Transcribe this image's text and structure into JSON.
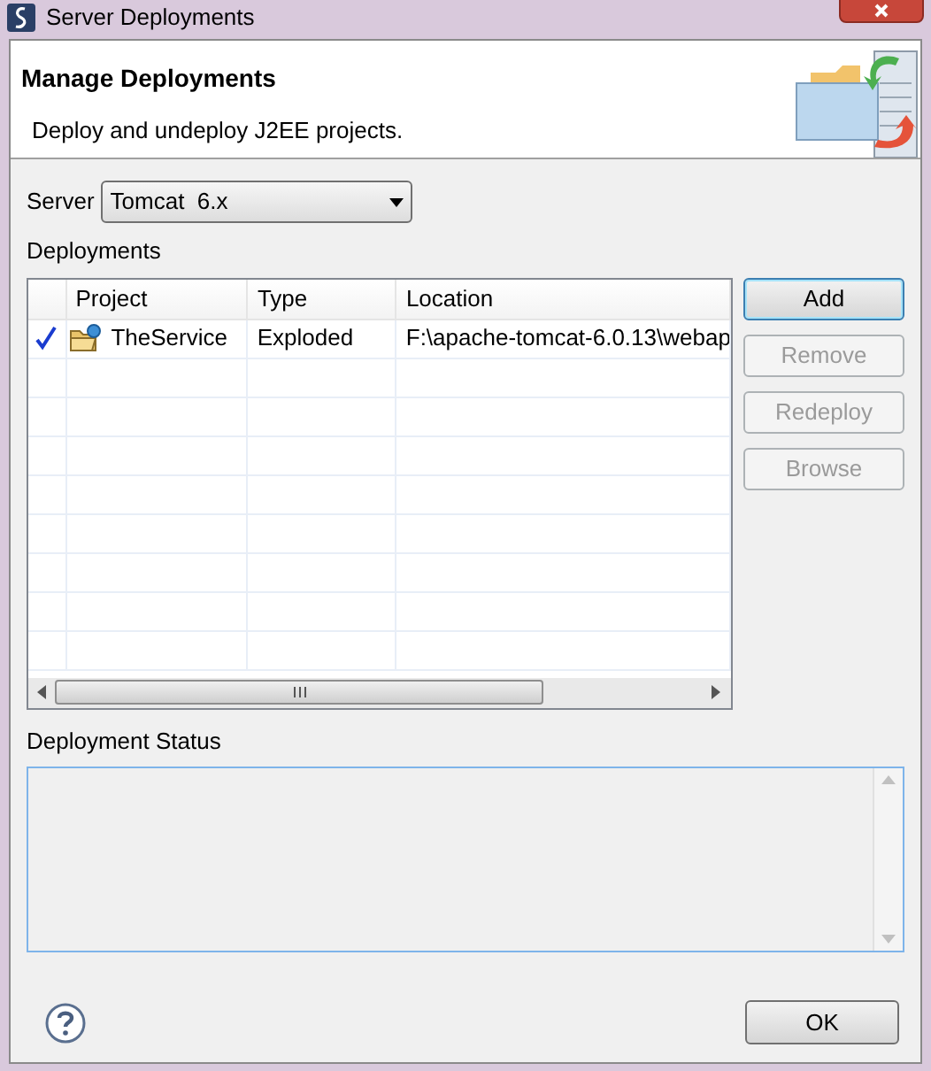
{
  "window": {
    "title": "Server Deployments"
  },
  "header": {
    "title": "Manage Deployments",
    "description": "Deploy and undeploy J2EE projects."
  },
  "server": {
    "label": "Server",
    "value": "Tomcat  6.x"
  },
  "deployments": {
    "label": "Deployments",
    "columns": [
      "Project",
      "Type",
      "Location"
    ],
    "rows": [
      {
        "checked": true,
        "project": "TheService",
        "type": "Exploded",
        "location": "F:\\apache-tomcat-6.0.13\\webap"
      }
    ]
  },
  "side_buttons": [
    {
      "label": "Add",
      "disabled": false,
      "focused": true
    },
    {
      "label": "Remove",
      "disabled": true
    },
    {
      "label": "Redeploy",
      "disabled": true
    },
    {
      "label": "Browse",
      "disabled": true
    }
  ],
  "status": {
    "label": "Deployment Status"
  },
  "footer": {
    "ok_button": "OK"
  }
}
